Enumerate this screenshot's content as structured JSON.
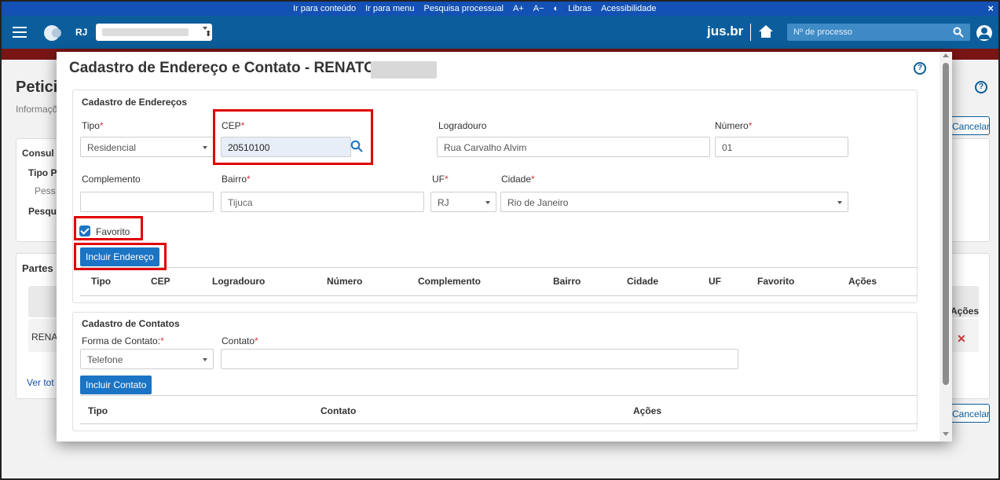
{
  "accessibility_bar": {
    "items": [
      "Ir para conteúdo",
      "Ir para menu",
      "Pesquisa processual",
      "A+",
      "A−",
      "◐",
      "Libras",
      "Acessibilidade"
    ],
    "close": "×"
  },
  "header": {
    "uf": "RJ",
    "brand": "jus.br",
    "search_placeholder": "Nº de processo"
  },
  "background": {
    "title": "Petici",
    "subtitle": "Informaçõ",
    "card1_title": "Consul",
    "tipo_label": "Tipo Pe",
    "tipo_value": "Pess",
    "pesquisa_label": "Pesqui",
    "partes_title": "Partes",
    "acoes_header": "Ações",
    "row_name": "RENAT",
    "ver_todos": "Ver tot",
    "cancel": "Cancelar"
  },
  "modal": {
    "title": "Cadastro de Endereço e Contato - RENATO",
    "enderecos": {
      "section_title": "Cadastro de Endereços",
      "tipo_label": "Tipo",
      "tipo_value": "Residencial",
      "cep_label": "CEP",
      "cep_value": "20510100",
      "logradouro_label": "Logradouro",
      "logradouro_value": "Rua Carvalho Alvim",
      "numero_label": "Número",
      "numero_value": "01",
      "complemento_label": "Complemento",
      "complemento_value": "",
      "bairro_label": "Bairro",
      "bairro_value": "Tijuca",
      "uf_label": "UF",
      "uf_value": "RJ",
      "cidade_label": "Cidade",
      "cidade_value": "Rio de Janeiro",
      "favorito_label": "Favorito",
      "favorito_checked": true,
      "incluir_button": "Incluir Endereço",
      "table_headers": [
        "Tipo",
        "CEP",
        "Logradouro",
        "Número",
        "Complemento",
        "Bairro",
        "Cidade",
        "UF",
        "Favorito",
        "Ações"
      ]
    },
    "contatos": {
      "section_title": "Cadastro de Contatos",
      "forma_label": "Forma de Contato:",
      "forma_value": "Telefone",
      "contato_label": "Contato",
      "contato_value": "",
      "incluir_button": "Incluir Contato",
      "table_headers": [
        "Tipo",
        "Contato",
        "Ações"
      ]
    }
  },
  "colors": {
    "accent_blue": "#1b74c4",
    "header_blue": "#0b5e9b",
    "access_bar": "#1351b4",
    "required": "#d9343a",
    "highlight_box": "#e00000"
  }
}
